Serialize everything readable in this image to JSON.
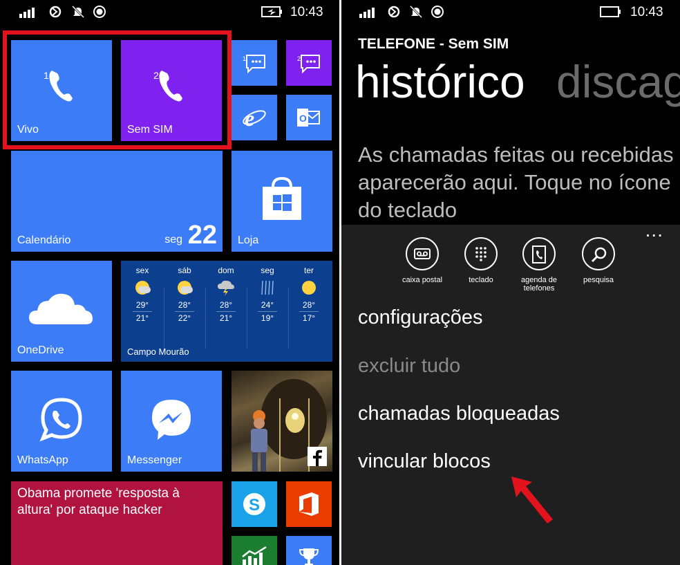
{
  "left_phone": {
    "status": {
      "time": "10:43"
    },
    "tiles": {
      "phone1": {
        "label": "Vivo",
        "badge": "1"
      },
      "phone2": {
        "label": "Sem SIM",
        "badge": "2"
      },
      "msg1_badge": "1",
      "msg2_badge": "2",
      "calendar": {
        "label": "Calendário",
        "day_name": "seg",
        "day_number": "22"
      },
      "store": {
        "label": "Loja"
      },
      "onedrive": {
        "label": "OneDrive"
      },
      "weather": {
        "location": "Campo Mourão",
        "days": [
          {
            "day": "sex",
            "icon": "partly-cloudy-icon",
            "high": "29°",
            "low": "21°"
          },
          {
            "day": "sáb",
            "icon": "partly-cloudy-icon",
            "high": "28°",
            "low": "22°"
          },
          {
            "day": "dom",
            "icon": "storm-icon",
            "high": "28°",
            "low": "21°"
          },
          {
            "day": "seg",
            "icon": "rain-icon",
            "high": "24°",
            "low": "19°"
          },
          {
            "day": "ter",
            "icon": "sun-icon",
            "high": "28°",
            "low": "17°"
          }
        ]
      },
      "whatsapp": {
        "label": "WhatsApp"
      },
      "messenger": {
        "label": "Messenger"
      },
      "news": {
        "headline": "Obama promete 'resposta à altura' por ataque hacker"
      }
    }
  },
  "right_phone": {
    "status": {
      "time": "10:43"
    },
    "app_title": "TELEFONE - Sem SIM",
    "pivot": {
      "active": "histórico",
      "next": "discag"
    },
    "empty_message": "As chamadas feitas ou recebidas aparecerão aqui. Toque no ícone do teclado",
    "app_bar": {
      "more": "...",
      "buttons": [
        {
          "label": "caixa postal",
          "icon": "voicemail-icon"
        },
        {
          "label": "teclado",
          "icon": "keypad-icon"
        },
        {
          "label": "agenda de telefones",
          "icon": "phonebook-icon"
        },
        {
          "label": "pesquisa",
          "icon": "search-icon"
        }
      ],
      "menu": [
        "configurações",
        "excluir tudo",
        "chamadas bloqueadas",
        "vincular blocos"
      ]
    }
  },
  "colors": {
    "tile_blue": "#3d7cf7",
    "tile_purple": "#7f21ef",
    "highlight_red": "#e2131d",
    "appbar": "#1f1f1f"
  }
}
